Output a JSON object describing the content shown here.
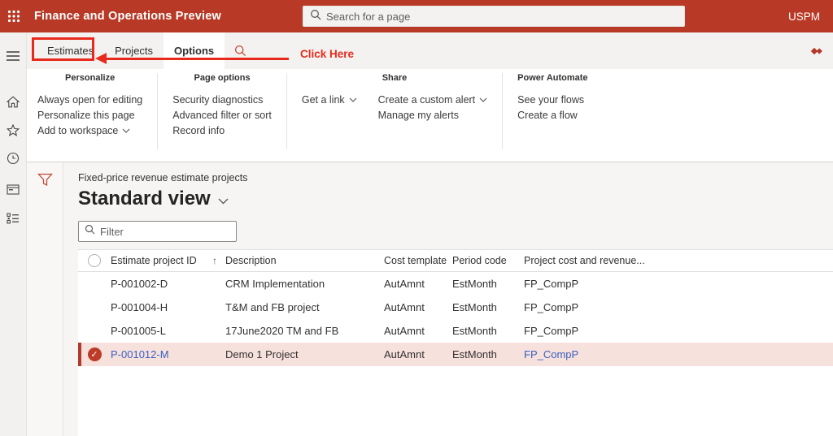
{
  "topbar": {
    "title": "Finance and Operations Preview",
    "search_placeholder": "Search for a page",
    "company": "USPM"
  },
  "tabs": {
    "items": [
      "Estimates",
      "Projects",
      "Options"
    ],
    "active": "Options"
  },
  "annotation": {
    "label": "Click Here",
    "color": "#e82a1d"
  },
  "ribbon": {
    "groups": [
      {
        "title": "Personalize",
        "items": [
          "Always open for editing",
          "Personalize this page",
          "Add to workspace"
        ]
      },
      {
        "title": "Page options",
        "items": [
          "Security diagnostics",
          "Advanced filter or sort",
          "Record info"
        ]
      },
      {
        "title": "Share",
        "col1": [
          "Get a link"
        ],
        "col2": [
          "Create a custom alert",
          "Manage my alerts"
        ]
      },
      {
        "title": "Power Automate",
        "items": [
          "See your flows",
          "Create a flow"
        ]
      }
    ]
  },
  "page": {
    "caption": "Fixed-price revenue estimate projects",
    "view_title": "Standard view",
    "filter_placeholder": "Filter"
  },
  "grid": {
    "columns": {
      "id": "Estimate project ID",
      "description": "Description",
      "cost_template": "Cost template",
      "period_code": "Period code",
      "revenue": "Project cost and revenue..."
    },
    "sort": {
      "column": "Estimate project ID",
      "direction": "ascending"
    },
    "rows": [
      {
        "id": "P-001002-D",
        "description": "CRM Implementation",
        "cost_template": "AutAmnt",
        "period_code": "EstMonth",
        "project_group": "FP_CompP",
        "selected": false
      },
      {
        "id": "P-001004-H",
        "description": "T&M and FB project",
        "cost_template": "AutAmnt",
        "period_code": "EstMonth",
        "project_group": "FP_CompP",
        "selected": false
      },
      {
        "id": "P-001005-L",
        "description": "17June2020 TM and FB",
        "cost_template": "AutAmnt",
        "period_code": "EstMonth",
        "project_group": "FP_CompP",
        "selected": false
      },
      {
        "id": "P-001012-M",
        "description": "Demo 1 Project",
        "cost_template": "AutAmnt",
        "period_code": "EstMonth",
        "project_group": "FP_CompP",
        "selected": true
      }
    ]
  },
  "icons": {
    "sort_ascending": "↑",
    "selected_check": "✓"
  },
  "colors": {
    "header": "#b83a26",
    "accent": "#b5392a",
    "annotation": "#e82a1d",
    "selected_row": "#f7e1dc",
    "link": "#3b5fc3"
  }
}
